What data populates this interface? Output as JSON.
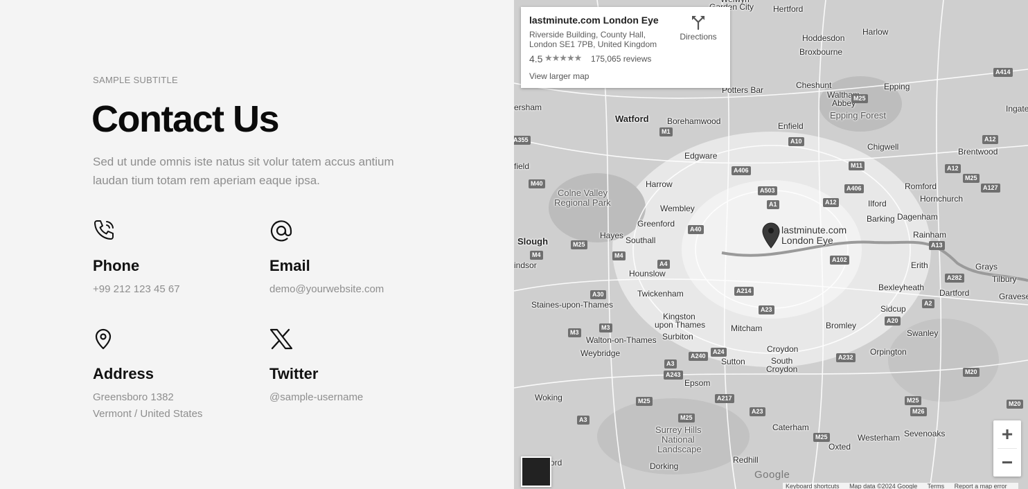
{
  "contact": {
    "subtitle": "SAMPLE SUBTITLE",
    "title": "Contact Us",
    "lead": "Sed ut unde omnis iste natus sit volur tatem accus antium laudan tium totam rem aperiam eaque ipsa.",
    "items": [
      {
        "icon": "phone-icon",
        "label": "Phone",
        "lines": [
          "+99 212 123 45 67"
        ]
      },
      {
        "icon": "at-icon",
        "label": "Email",
        "lines": [
          "demo@yourwebsite.com"
        ]
      },
      {
        "icon": "location-pin-icon",
        "label": "Address",
        "lines": [
          "Greensboro 1382",
          "Vermont / United States"
        ]
      },
      {
        "icon": "x-logo-icon",
        "label": "Twitter",
        "lines": [
          "@sample-username"
        ]
      }
    ]
  },
  "map": {
    "place_card": {
      "name": "lastminute.com London Eye",
      "address": "Riverside Building, County Hall, London SE1 7PB, United Kingdom",
      "rating": "4.5",
      "stars": "★★★★★",
      "reviews": "175,065 reviews",
      "larger_map": "View larger map",
      "directions": "Directions"
    },
    "pin_label": [
      "lastminute.com",
      "London Eye"
    ],
    "zoom_in": "+",
    "zoom_out": "−",
    "logo": "Google",
    "attribution": [
      "Keyboard shortcuts",
      "Map data ©2024 Google",
      "Terms",
      "Report a map error"
    ],
    "places": [
      {
        "name": "Welwyn",
        "cls": "",
        "pos": "left:298px;top:-8px"
      },
      {
        "name": "Garden City",
        "cls": "",
        "pos": "left:282px;top:3px"
      },
      {
        "name": "Hertford",
        "cls": "",
        "pos": "left:374px;top:6px"
      },
      {
        "name": "Harlow",
        "cls": "",
        "pos": "left:503px;top:39px"
      },
      {
        "name": "Hoddesdon",
        "cls": "",
        "pos": "left:416px;top:48px"
      },
      {
        "name": "Broxbourne",
        "cls": "",
        "pos": "left:412px;top:68px"
      },
      {
        "name": "Cheshunt",
        "cls": "",
        "pos": "left:407px;top:116px"
      },
      {
        "name": "Waltham",
        "cls": "",
        "pos": "left:452px;top:130px"
      },
      {
        "name": "Abbey",
        "cls": "",
        "pos": "left:459px;top:142px"
      },
      {
        "name": "Epping",
        "cls": "",
        "pos": "left:534px;top:118px"
      },
      {
        "name": "Epping Forest",
        "cls": "area",
        "pos": "left:456px;top:160px"
      },
      {
        "name": "Ingate",
        "cls": "",
        "pos": "left:710px;top:150px"
      },
      {
        "name": "Potters Bar",
        "cls": "",
        "pos": "left:300px;top:123px"
      },
      {
        "name": "ersham",
        "cls": "",
        "pos": "left:0px;top:148px"
      },
      {
        "name": "Watford",
        "cls": "big",
        "pos": "left:146px;top:164px"
      },
      {
        "name": "Borehamwood",
        "cls": "",
        "pos": "left:221px;top:168px"
      },
      {
        "name": "Enfield",
        "cls": "",
        "pos": "left:381px;top:175px"
      },
      {
        "name": "Chigwell",
        "cls": "",
        "pos": "left:510px;top:205px"
      },
      {
        "name": "Brentwood",
        "cls": "",
        "pos": "left:641px;top:212px"
      },
      {
        "name": "field",
        "cls": "",
        "pos": "left:0px;top:233px"
      },
      {
        "name": "Edgware",
        "cls": "",
        "pos": "left:246px;top:218px"
      },
      {
        "name": "Romford",
        "cls": "",
        "pos": "left:564px;top:262px"
      },
      {
        "name": "Hornchurch",
        "cls": "",
        "pos": "left:586px;top:280px"
      },
      {
        "name": "Colne Valley",
        "cls": "area",
        "pos": "left:63px;top:272px"
      },
      {
        "name": "Regional Park",
        "cls": "area",
        "pos": "left:58px;top:286px"
      },
      {
        "name": "Harrow",
        "cls": "",
        "pos": "left:190px;top:259px"
      },
      {
        "name": "Ilford",
        "cls": "",
        "pos": "left:511px;top:287px"
      },
      {
        "name": "Wembley",
        "cls": "",
        "pos": "left:211px;top:294px"
      },
      {
        "name": "Barking",
        "cls": "",
        "pos": "left:509px;top:309px"
      },
      {
        "name": "Dagenham",
        "cls": "",
        "pos": "left:553px;top:306px"
      },
      {
        "name": "Greenford",
        "cls": "",
        "pos": "left:178px;top:316px"
      },
      {
        "name": "Rainham",
        "cls": "",
        "pos": "left:576px;top:332px"
      },
      {
        "name": "Slough",
        "cls": "big",
        "pos": "left:5px;top:341px"
      },
      {
        "name": "Hayes",
        "cls": "",
        "pos": "left:124px;top:333px"
      },
      {
        "name": "Southall",
        "cls": "",
        "pos": "left:161px;top:340px"
      },
      {
        "name": "indsor",
        "cls": "",
        "pos": "left:0px;top:376px"
      },
      {
        "name": "Erith",
        "cls": "",
        "pos": "left:573px;top:376px"
      },
      {
        "name": "Grays",
        "cls": "",
        "pos": "left:666px;top:378px"
      },
      {
        "name": "Tilbury",
        "cls": "",
        "pos": "left:690px;top:396px"
      },
      {
        "name": "Hounslow",
        "cls": "",
        "pos": "left:166px;top:388px"
      },
      {
        "name": "Bexleyheath",
        "cls": "",
        "pos": "left:526px;top:408px"
      },
      {
        "name": "Dartford",
        "cls": "",
        "pos": "left:614px;top:416px"
      },
      {
        "name": "Gravese",
        "cls": "",
        "pos": "left:700px;top:421px"
      },
      {
        "name": "Twickenham",
        "cls": "",
        "pos": "left:178px;top:417px"
      },
      {
        "name": "Staines-upon-Thames",
        "cls": "",
        "pos": "left:25px;top:433px"
      },
      {
        "name": "Sidcup",
        "cls": "",
        "pos": "left:529px;top:439px"
      },
      {
        "name": "Kingston",
        "cls": "",
        "pos": "left:215px;top:450px"
      },
      {
        "name": "upon Thames",
        "cls": "",
        "pos": "left:203px;top:462px"
      },
      {
        "name": "Mitcham",
        "cls": "",
        "pos": "left:313px;top:467px"
      },
      {
        "name": "Bromley",
        "cls": "",
        "pos": "left:450px;top:463px"
      },
      {
        "name": "Swanley",
        "cls": "",
        "pos": "left:567px;top:474px"
      },
      {
        "name": "Surbiton",
        "cls": "",
        "pos": "left:214px;top:479px"
      },
      {
        "name": "Walton-on-Thames",
        "cls": "",
        "pos": "left:104px;top:484px"
      },
      {
        "name": "Croydon",
        "cls": "",
        "pos": "left:365px;top:497px"
      },
      {
        "name": "Orpington",
        "cls": "",
        "pos": "left:514px;top:501px"
      },
      {
        "name": "Weybridge",
        "cls": "",
        "pos": "left:96px;top:503px"
      },
      {
        "name": "Sutton",
        "cls": "",
        "pos": "left:299px;top:515px"
      },
      {
        "name": "South",
        "cls": "",
        "pos": "left:371px;top:514px"
      },
      {
        "name": "Croydon",
        "cls": "",
        "pos": "left:364px;top:526px"
      },
      {
        "name": "Epsom",
        "cls": "",
        "pos": "left:246px;top:546px"
      },
      {
        "name": "Woking",
        "cls": "",
        "pos": "left:30px;top:567px"
      },
      {
        "name": "Caterham",
        "cls": "",
        "pos": "left:373px;top:610px"
      },
      {
        "name": "Surrey Hills",
        "cls": "area",
        "pos": "left:204px;top:614px"
      },
      {
        "name": "National",
        "cls": "area",
        "pos": "left:213px;top:628px"
      },
      {
        "name": "Landscape",
        "cls": "area",
        "pos": "left:207px;top:642px"
      },
      {
        "name": "Westerham",
        "cls": "",
        "pos": "left:496px;top:625px"
      },
      {
        "name": "Sevenoaks",
        "cls": "",
        "pos": "left:563px;top:619px"
      },
      {
        "name": "Oxted",
        "cls": "",
        "pos": "left:454px;top:638px"
      },
      {
        "name": "Redhill",
        "cls": "",
        "pos": "left:316px;top:657px"
      },
      {
        "name": "Dorking",
        "cls": "",
        "pos": "left:196px;top:666px"
      },
      {
        "name": "ord",
        "cls": "",
        "pos": "left:52px;top:661px"
      }
    ],
    "roads": [
      {
        "name": "A414",
        "pos": "left:692px;top:98px"
      },
      {
        "name": "M25",
        "pos": "left:487px;top:136px"
      },
      {
        "name": "A12",
        "pos": "left:676px;top:195px"
      },
      {
        "name": "A355",
        "pos": "left:-4px;top:196px"
      },
      {
        "name": "M1",
        "pos": "left:210px;top:184px"
      },
      {
        "name": "A10",
        "pos": "left:396px;top:198px"
      },
      {
        "name": "M11",
        "pos": "left:483px;top:233px"
      },
      {
        "name": "A12",
        "pos": "left:622px;top:237px"
      },
      {
        "name": "A406",
        "pos": "left:314px;top:240px"
      },
      {
        "name": "M25",
        "pos": "left:648px;top:251px"
      },
      {
        "name": "M40",
        "pos": "left:21px;top:259px"
      },
      {
        "name": "A503",
        "pos": "left:352px;top:269px"
      },
      {
        "name": "A406",
        "pos": "left:477px;top:266px"
      },
      {
        "name": "A127",
        "pos": "left:674px;top:265px"
      },
      {
        "name": "A1",
        "pos": "left:365px;top:289px"
      },
      {
        "name": "A12",
        "pos": "left:446px;top:286px"
      },
      {
        "name": "A40",
        "pos": "left:251px;top:325px"
      },
      {
        "name": "M25",
        "pos": "left:82px;top:347px"
      },
      {
        "name": "A13",
        "pos": "left:599px;top:348px"
      },
      {
        "name": "M4",
        "pos": "left:23px;top:362px"
      },
      {
        "name": "M4",
        "pos": "left:142px;top:363px"
      },
      {
        "name": "A102",
        "pos": "left:456px;top:369px"
      },
      {
        "name": "A4",
        "pos": "left:207px;top:375px"
      },
      {
        "name": "A282",
        "pos": "left:622px;top:395px"
      },
      {
        "name": "A214",
        "pos": "left:318px;top:414px"
      },
      {
        "name": "A30",
        "pos": "left:110px;top:419px"
      },
      {
        "name": "A2",
        "pos": "left:589px;top:432px"
      },
      {
        "name": "A23",
        "pos": "left:353px;top:441px"
      },
      {
        "name": "A20",
        "pos": "left:535px;top:457px"
      },
      {
        "name": "M3",
        "pos": "left:123px;top:467px"
      },
      {
        "name": "M3",
        "pos": "left:78px;top:474px"
      },
      {
        "name": "A24",
        "pos": "left:284px;top:502px"
      },
      {
        "name": "A240",
        "pos": "left:252px;top:508px"
      },
      {
        "name": "A232",
        "pos": "left:465px;top:510px"
      },
      {
        "name": "A3",
        "pos": "left:217px;top:519px"
      },
      {
        "name": "A243",
        "pos": "left:216px;top:535px"
      },
      {
        "name": "M20",
        "pos": "left:648px;top:531px"
      },
      {
        "name": "A217",
        "pos": "left:290px;top:569px"
      },
      {
        "name": "M25",
        "pos": "left:176px;top:573px"
      },
      {
        "name": "M25",
        "pos": "left:564px;top:572px"
      },
      {
        "name": "M20",
        "pos": "left:711px;top:577px"
      },
      {
        "name": "A23",
        "pos": "left:340px;top:588px"
      },
      {
        "name": "M26",
        "pos": "left:572px;top:588px"
      },
      {
        "name": "A3",
        "pos": "left:91px;top:600px"
      },
      {
        "name": "M25",
        "pos": "left:237px;top:597px"
      },
      {
        "name": "M25",
        "pos": "left:432px;top:625px"
      }
    ]
  }
}
